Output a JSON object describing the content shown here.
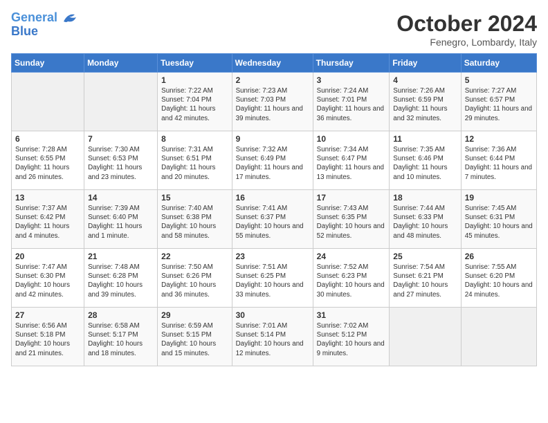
{
  "header": {
    "logo_line1": "General",
    "logo_line2": "Blue",
    "month_title": "October 2024",
    "subtitle": "Fenegro, Lombardy, Italy"
  },
  "weekdays": [
    "Sunday",
    "Monday",
    "Tuesday",
    "Wednesday",
    "Thursday",
    "Friday",
    "Saturday"
  ],
  "weeks": [
    [
      {
        "day": "",
        "empty": true
      },
      {
        "day": "",
        "empty": true
      },
      {
        "day": "1",
        "sunrise": "Sunrise: 7:22 AM",
        "sunset": "Sunset: 7:04 PM",
        "daylight": "Daylight: 11 hours and 42 minutes."
      },
      {
        "day": "2",
        "sunrise": "Sunrise: 7:23 AM",
        "sunset": "Sunset: 7:03 PM",
        "daylight": "Daylight: 11 hours and 39 minutes."
      },
      {
        "day": "3",
        "sunrise": "Sunrise: 7:24 AM",
        "sunset": "Sunset: 7:01 PM",
        "daylight": "Daylight: 11 hours and 36 minutes."
      },
      {
        "day": "4",
        "sunrise": "Sunrise: 7:26 AM",
        "sunset": "Sunset: 6:59 PM",
        "daylight": "Daylight: 11 hours and 32 minutes."
      },
      {
        "day": "5",
        "sunrise": "Sunrise: 7:27 AM",
        "sunset": "Sunset: 6:57 PM",
        "daylight": "Daylight: 11 hours and 29 minutes."
      }
    ],
    [
      {
        "day": "6",
        "sunrise": "Sunrise: 7:28 AM",
        "sunset": "Sunset: 6:55 PM",
        "daylight": "Daylight: 11 hours and 26 minutes."
      },
      {
        "day": "7",
        "sunrise": "Sunrise: 7:30 AM",
        "sunset": "Sunset: 6:53 PM",
        "daylight": "Daylight: 11 hours and 23 minutes."
      },
      {
        "day": "8",
        "sunrise": "Sunrise: 7:31 AM",
        "sunset": "Sunset: 6:51 PM",
        "daylight": "Daylight: 11 hours and 20 minutes."
      },
      {
        "day": "9",
        "sunrise": "Sunrise: 7:32 AM",
        "sunset": "Sunset: 6:49 PM",
        "daylight": "Daylight: 11 hours and 17 minutes."
      },
      {
        "day": "10",
        "sunrise": "Sunrise: 7:34 AM",
        "sunset": "Sunset: 6:47 PM",
        "daylight": "Daylight: 11 hours and 13 minutes."
      },
      {
        "day": "11",
        "sunrise": "Sunrise: 7:35 AM",
        "sunset": "Sunset: 6:46 PM",
        "daylight": "Daylight: 11 hours and 10 minutes."
      },
      {
        "day": "12",
        "sunrise": "Sunrise: 7:36 AM",
        "sunset": "Sunset: 6:44 PM",
        "daylight": "Daylight: 11 hours and 7 minutes."
      }
    ],
    [
      {
        "day": "13",
        "sunrise": "Sunrise: 7:37 AM",
        "sunset": "Sunset: 6:42 PM",
        "daylight": "Daylight: 11 hours and 4 minutes."
      },
      {
        "day": "14",
        "sunrise": "Sunrise: 7:39 AM",
        "sunset": "Sunset: 6:40 PM",
        "daylight": "Daylight: 11 hours and 1 minute."
      },
      {
        "day": "15",
        "sunrise": "Sunrise: 7:40 AM",
        "sunset": "Sunset: 6:38 PM",
        "daylight": "Daylight: 10 hours and 58 minutes."
      },
      {
        "day": "16",
        "sunrise": "Sunrise: 7:41 AM",
        "sunset": "Sunset: 6:37 PM",
        "daylight": "Daylight: 10 hours and 55 minutes."
      },
      {
        "day": "17",
        "sunrise": "Sunrise: 7:43 AM",
        "sunset": "Sunset: 6:35 PM",
        "daylight": "Daylight: 10 hours and 52 minutes."
      },
      {
        "day": "18",
        "sunrise": "Sunrise: 7:44 AM",
        "sunset": "Sunset: 6:33 PM",
        "daylight": "Daylight: 10 hours and 48 minutes."
      },
      {
        "day": "19",
        "sunrise": "Sunrise: 7:45 AM",
        "sunset": "Sunset: 6:31 PM",
        "daylight": "Daylight: 10 hours and 45 minutes."
      }
    ],
    [
      {
        "day": "20",
        "sunrise": "Sunrise: 7:47 AM",
        "sunset": "Sunset: 6:30 PM",
        "daylight": "Daylight: 10 hours and 42 minutes."
      },
      {
        "day": "21",
        "sunrise": "Sunrise: 7:48 AM",
        "sunset": "Sunset: 6:28 PM",
        "daylight": "Daylight: 10 hours and 39 minutes."
      },
      {
        "day": "22",
        "sunrise": "Sunrise: 7:50 AM",
        "sunset": "Sunset: 6:26 PM",
        "daylight": "Daylight: 10 hours and 36 minutes."
      },
      {
        "day": "23",
        "sunrise": "Sunrise: 7:51 AM",
        "sunset": "Sunset: 6:25 PM",
        "daylight": "Daylight: 10 hours and 33 minutes."
      },
      {
        "day": "24",
        "sunrise": "Sunrise: 7:52 AM",
        "sunset": "Sunset: 6:23 PM",
        "daylight": "Daylight: 10 hours and 30 minutes."
      },
      {
        "day": "25",
        "sunrise": "Sunrise: 7:54 AM",
        "sunset": "Sunset: 6:21 PM",
        "daylight": "Daylight: 10 hours and 27 minutes."
      },
      {
        "day": "26",
        "sunrise": "Sunrise: 7:55 AM",
        "sunset": "Sunset: 6:20 PM",
        "daylight": "Daylight: 10 hours and 24 minutes."
      }
    ],
    [
      {
        "day": "27",
        "sunrise": "Sunrise: 6:56 AM",
        "sunset": "Sunset: 5:18 PM",
        "daylight": "Daylight: 10 hours and 21 minutes."
      },
      {
        "day": "28",
        "sunrise": "Sunrise: 6:58 AM",
        "sunset": "Sunset: 5:17 PM",
        "daylight": "Daylight: 10 hours and 18 minutes."
      },
      {
        "day": "29",
        "sunrise": "Sunrise: 6:59 AM",
        "sunset": "Sunset: 5:15 PM",
        "daylight": "Daylight: 10 hours and 15 minutes."
      },
      {
        "day": "30",
        "sunrise": "Sunrise: 7:01 AM",
        "sunset": "Sunset: 5:14 PM",
        "daylight": "Daylight: 10 hours and 12 minutes."
      },
      {
        "day": "31",
        "sunrise": "Sunrise: 7:02 AM",
        "sunset": "Sunset: 5:12 PM",
        "daylight": "Daylight: 10 hours and 9 minutes."
      },
      {
        "day": "",
        "empty": true
      },
      {
        "day": "",
        "empty": true
      }
    ]
  ]
}
